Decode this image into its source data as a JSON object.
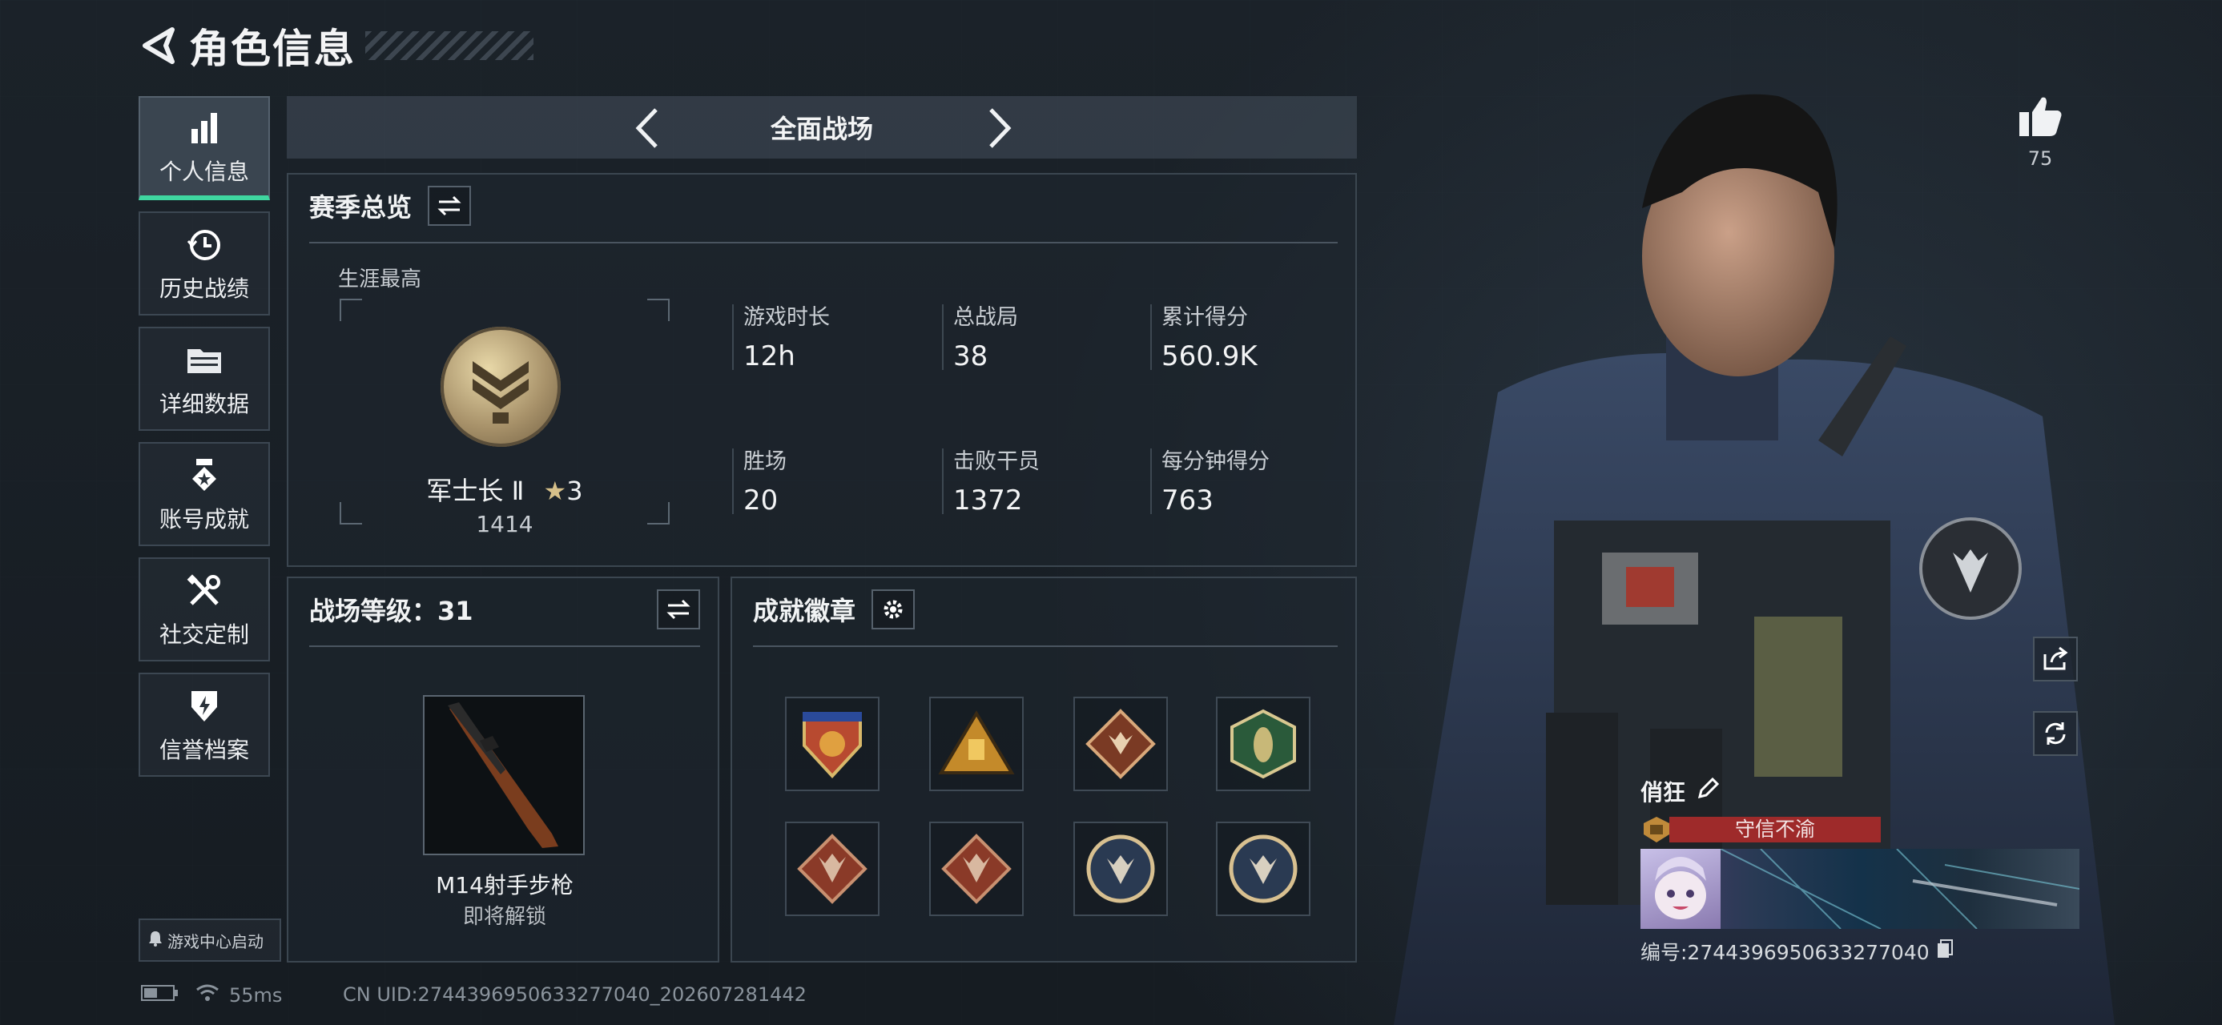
{
  "header": {
    "title": "角色信息"
  },
  "sidebar": {
    "items": [
      {
        "label": "个人信息",
        "icon": "bar-chart-icon",
        "active": true
      },
      {
        "label": "历史战绩",
        "icon": "clock-history-icon"
      },
      {
        "label": "详细数据",
        "icon": "folder-icon"
      },
      {
        "label": "账号成就",
        "icon": "medal-icon"
      },
      {
        "label": "社交定制",
        "icon": "tools-icon"
      },
      {
        "label": "信誉档案",
        "icon": "shield-icon"
      }
    ],
    "game_center": "游戏中心启动"
  },
  "mode": {
    "title": "全面战场"
  },
  "season": {
    "title": "赛季总览",
    "career_label": "生涯最高",
    "rank_name": "军士长 Ⅱ",
    "rank_stars": "3",
    "rank_score": "1414",
    "stats": [
      {
        "label": "游戏时长",
        "value": "12h"
      },
      {
        "label": "总战局",
        "value": "38"
      },
      {
        "label": "累计得分",
        "value": "560.9K"
      },
      {
        "label": "胜场",
        "value": "20"
      },
      {
        "label": "击败干员",
        "value": "1372"
      },
      {
        "label": "每分钟得分",
        "value": "763"
      }
    ]
  },
  "level": {
    "title": "战场等级：31",
    "weapon_name": "M14射手步枪",
    "weapon_status": "即将解锁"
  },
  "badges": {
    "title": "成就徽章",
    "items": [
      "crest-shield-badge",
      "triangle-emblem-badge",
      "wolf-diamond-badge",
      "wasp-hexagon-badge",
      "dragon-diamond-badge",
      "dragon-diamond-badge",
      "wolf-circle-badge",
      "wolf-circle-badge"
    ]
  },
  "status": {
    "ping": "55ms",
    "uid": "CN UID:2744396950633277040_202607281442"
  },
  "profile": {
    "likes": "75",
    "name": "俏狂",
    "tag": "守信不渝",
    "id_label": "编号:2744396950633277040"
  },
  "colors": {
    "accent": "#3fd6a0",
    "tag": "#9e2a2a",
    "gold": "#d6c08a"
  }
}
